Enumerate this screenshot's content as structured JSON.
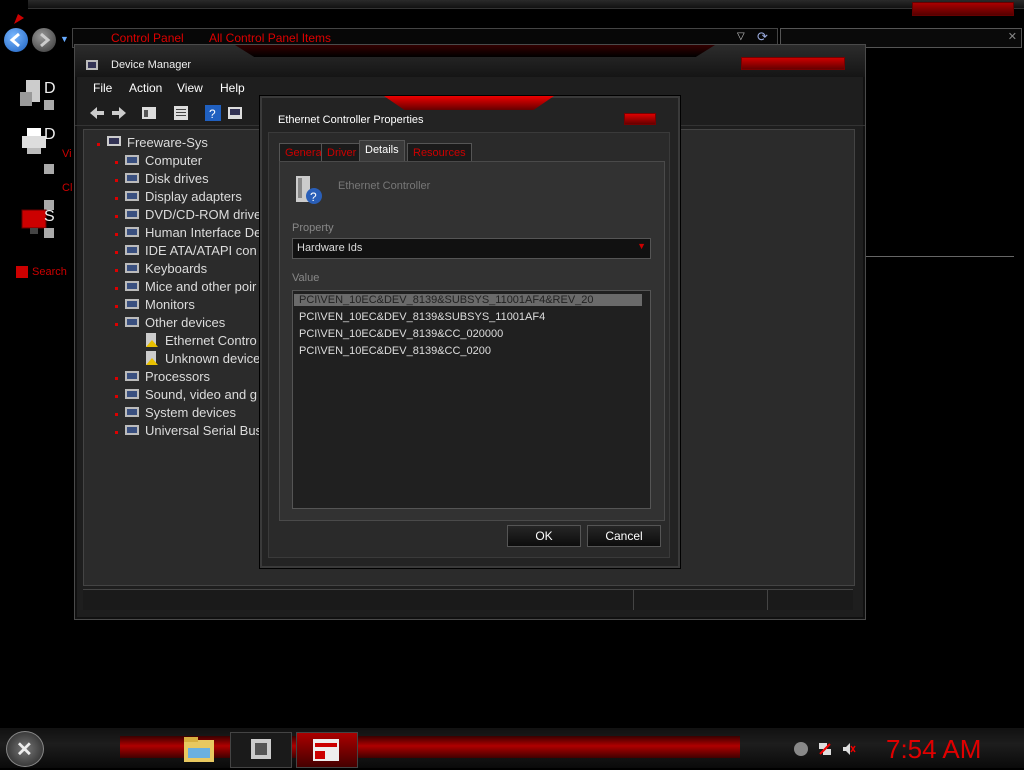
{
  "background_window": {
    "address_crumbs": [
      "Control Panel",
      "All Control Panel Items"
    ],
    "left_items": [
      {
        "letter": "D",
        "sub": ""
      },
      {
        "letter": "D",
        "sub": "Vi",
        "sub2": "Cl"
      },
      {
        "letter": "S",
        "sub": ""
      }
    ],
    "search_link": "Search"
  },
  "device_manager": {
    "title": "Device Manager",
    "menu": [
      "File",
      "Action",
      "View",
      "Help"
    ],
    "tree_root": "Freeware-Sys",
    "tree_items": [
      "Computer",
      "Disk drives",
      "Display adapters",
      "DVD/CD-ROM drive",
      "Human Interface De",
      "IDE ATA/ATAPI con",
      "Keyboards",
      "Mice and other poir",
      "Monitors",
      "Other devices",
      "Ethernet Contro",
      "Unknown device",
      "Processors",
      "Sound, video and g",
      "System devices",
      "Universal Serial Bus"
    ]
  },
  "dialog": {
    "title": "Ethernet Controller Properties",
    "tabs": [
      "General",
      "Driver",
      "Details",
      "Resources"
    ],
    "active_tab": "Details",
    "device_name": "Ethernet Controller",
    "property_label": "Property",
    "property_value": "Hardware Ids",
    "value_label": "Value",
    "values": [
      "PCI\\VEN_10EC&DEV_8139&SUBSYS_11001AF4&REV_20",
      "PCI\\VEN_10EC&DEV_8139&SUBSYS_11001AF4",
      "PCI\\VEN_10EC&DEV_8139&CC_020000",
      "PCI\\VEN_10EC&DEV_8139&CC_0200"
    ],
    "ok_label": "OK",
    "cancel_label": "Cancel"
  },
  "taskbar": {
    "clock": "7:54 AM"
  },
  "colors": {
    "accent_red": "#d00000",
    "background": "#000000"
  }
}
